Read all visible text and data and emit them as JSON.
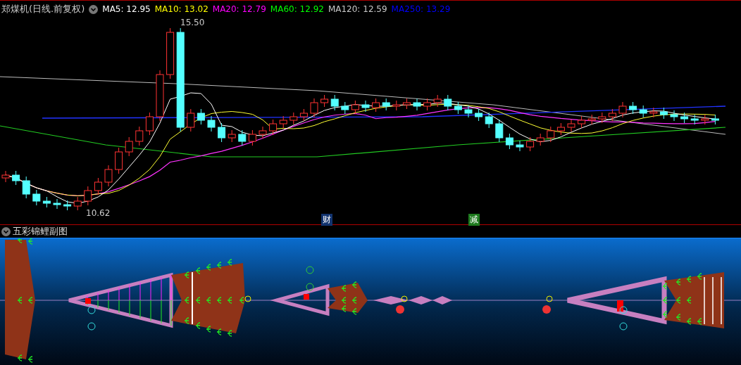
{
  "main_chart": {
    "title": "郑煤机(日线.前复权)",
    "ma_items": [
      {
        "label": "MA5:",
        "value": "12.95",
        "color": "#ffffff"
      },
      {
        "label": "MA10:",
        "value": "13.02",
        "color": "#ffff00"
      },
      {
        "label": "MA20:",
        "value": "12.79",
        "color": "#ff00ff"
      },
      {
        "label": "MA60:",
        "value": "12.92",
        "color": "#00ff00"
      },
      {
        "label": "MA120:",
        "value": "12.59",
        "color": "#c8c8c8"
      },
      {
        "label": "MA250:",
        "value": "13.29",
        "color": "#0000ff"
      }
    ],
    "high_label": "15.50",
    "low_label": "10.62",
    "markers": [
      {
        "text": "财",
        "color": "#12336e"
      },
      {
        "text": "减",
        "color": "#1e7a1e"
      }
    ]
  },
  "sub_chart": {
    "title": "五彩锦鲤副图"
  }
}
